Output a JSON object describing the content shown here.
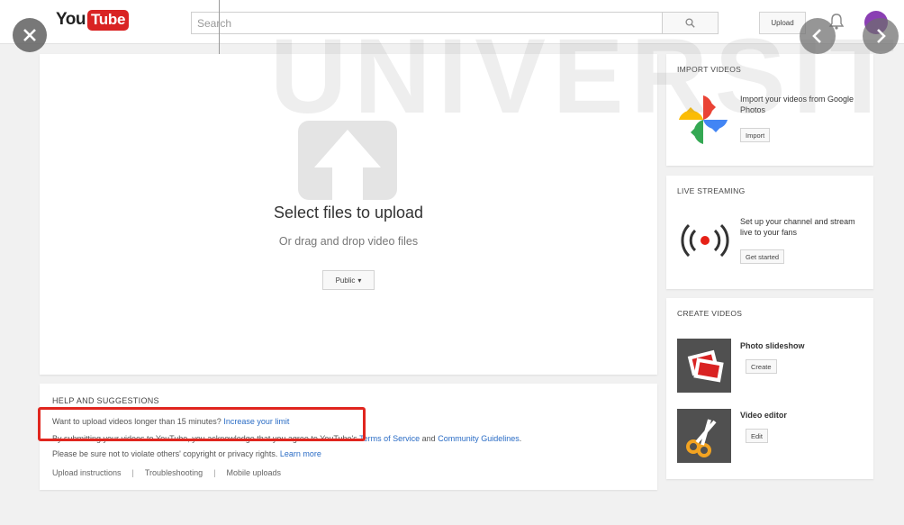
{
  "header": {
    "logo_you": "You",
    "logo_tube": "Tube",
    "search_placeholder": "Search",
    "upload_label": "Upload"
  },
  "watermark": "UNIVERSITY",
  "upload": {
    "title": "Select files to upload",
    "subtitle": "Or drag and drop video files",
    "privacy_value": "Public"
  },
  "help": {
    "heading": "HELP AND SUGGESTIONS",
    "limit_text": "Want to upload videos longer than 15 minutes?",
    "limit_link": "Increase your limit",
    "terms_prefix": "By submitting your videos to YouTube, you acknowledge that you agree to YouTube's",
    "terms_link": "Terms of Service",
    "terms_and": "and",
    "guidelines_link": "Community Guidelines",
    "terms_suffix": ".",
    "rights_text": "Please be sure not to violate others' copyright or privacy rights.",
    "learn_more": "Learn more",
    "links": [
      "Upload instructions",
      "Troubleshooting",
      "Mobile uploads"
    ]
  },
  "sidebar": {
    "import": {
      "title": "IMPORT VIDEOS",
      "desc": "Import your videos from Google Photos",
      "button": "Import"
    },
    "live": {
      "title": "LIVE STREAMING",
      "desc": "Set up your channel and stream live to your fans",
      "button": "Get started"
    },
    "create": {
      "title": "CREATE VIDEOS",
      "items": [
        {
          "label": "Photo slideshow",
          "button": "Create"
        },
        {
          "label": "Video editor",
          "button": "Edit"
        }
      ]
    }
  },
  "colors": {
    "brand_red": "#d92323",
    "link_blue": "#2a6cc5",
    "highlight_red": "#e0261f"
  }
}
